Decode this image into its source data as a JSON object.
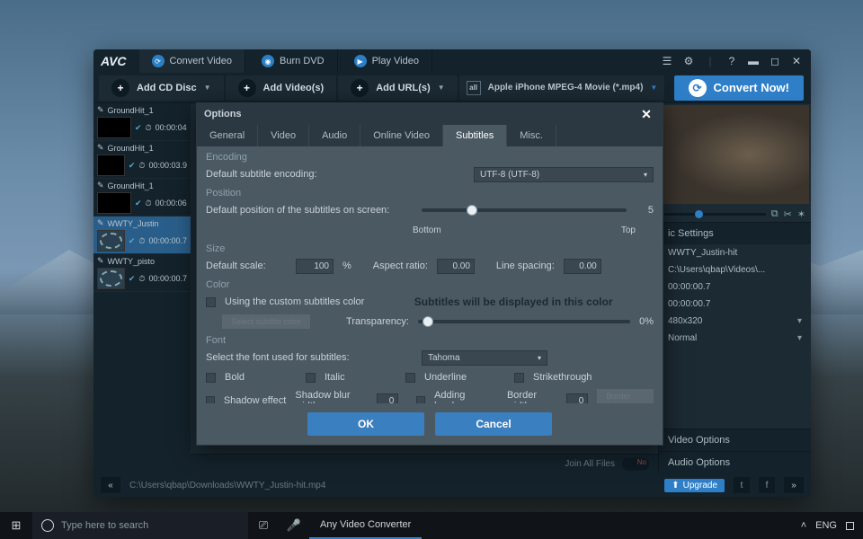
{
  "app": {
    "logo": "AVC",
    "tabs": [
      {
        "label": "Convert Video",
        "active": true
      },
      {
        "label": "Burn DVD",
        "active": false
      },
      {
        "label": "Play Video",
        "active": false
      }
    ],
    "toolbar": {
      "add_cd": "Add CD Disc",
      "add_videos": "Add Video(s)",
      "add_urls": "Add URL(s)",
      "output_format": "Apple iPhone MPEG-4 Movie (*.mp4)",
      "convert": "Convert Now!"
    },
    "files": [
      {
        "name": "GroundHit_1",
        "time": "00:00:04",
        "thumb": "dark"
      },
      {
        "name": "GroundHit_1",
        "time": "00:00:03.9",
        "thumb": "dark"
      },
      {
        "name": "GroundHit_1",
        "time": "00:00:06",
        "thumb": "dark"
      },
      {
        "name": "WWTY_Justin",
        "time": "00:00:00.7",
        "thumb": "film",
        "selected": true
      },
      {
        "name": "WWTY_pisto",
        "time": "00:00:00.7",
        "thumb": "film"
      }
    ],
    "join_label": "Join All Files",
    "join_state": "No",
    "status_path": "C:\\Users\\qbap\\Downloads\\WWTY_Justin-hit.mp4",
    "upgrade": "Upgrade"
  },
  "side": {
    "hdr": "ic Settings",
    "rows": [
      {
        "l": "",
        "v": "WWTY_Justin-hit"
      },
      {
        "l": "",
        "v": "C:\\Users\\qbap\\Videos\\..."
      },
      {
        "l": "",
        "v": "00:00:00.7"
      },
      {
        "l": "",
        "v": "00:00:00.7"
      },
      {
        "l": "",
        "v": "480x320"
      },
      {
        "l": "",
        "v": "Normal"
      }
    ],
    "video_opt": "Video Options",
    "audio_opt": "Audio Options"
  },
  "modal": {
    "title": "Options",
    "tabs": [
      "General",
      "Video",
      "Audio",
      "Online Video",
      "Subtitles",
      "Misc."
    ],
    "active_tab": "Subtitles",
    "encoding": {
      "hdr": "Encoding",
      "label": "Default subtitle encoding:",
      "value": "UTF-8 (UTF-8)"
    },
    "position": {
      "hdr": "Position",
      "label": "Default position of the subtitles on screen:",
      "value": "5",
      "bottom": "Bottom",
      "top": "Top",
      "pct": 22
    },
    "size": {
      "hdr": "Size",
      "scale_label": "Default scale:",
      "scale_value": "100",
      "scale_unit": "%",
      "aspect_label": "Aspect ratio:",
      "aspect_value": "0.00",
      "spacing_label": "Line spacing:",
      "spacing_value": "0.00"
    },
    "color": {
      "hdr": "Color",
      "use_custom": "Using the custom subtitles color",
      "select_btn": "Select subtitle color",
      "preview": "Subtitles will be displayed in this color",
      "transparency_label": "Transparency:",
      "transparency_value": "0%",
      "transparency_pct": 2
    },
    "font": {
      "hdr": "Font",
      "select_label": "Select the font used for subtitles:",
      "value": "Tahoma",
      "bold": "Bold",
      "italic": "Italic",
      "underline": "Underline",
      "strike": "Strikethrough",
      "shadow": "Shadow effect",
      "shadow_blur_label": "Shadow blur width:",
      "shadow_blur_value": "0",
      "borders": "Adding borders",
      "border_width_label": "Border width:",
      "border_width_value": "0",
      "border_color_btn": "Border color"
    },
    "ok": "OK",
    "cancel": "Cancel"
  },
  "taskbar": {
    "search_placeholder": "Type here to search",
    "app": "Any Video Converter",
    "lang": "ENG"
  }
}
